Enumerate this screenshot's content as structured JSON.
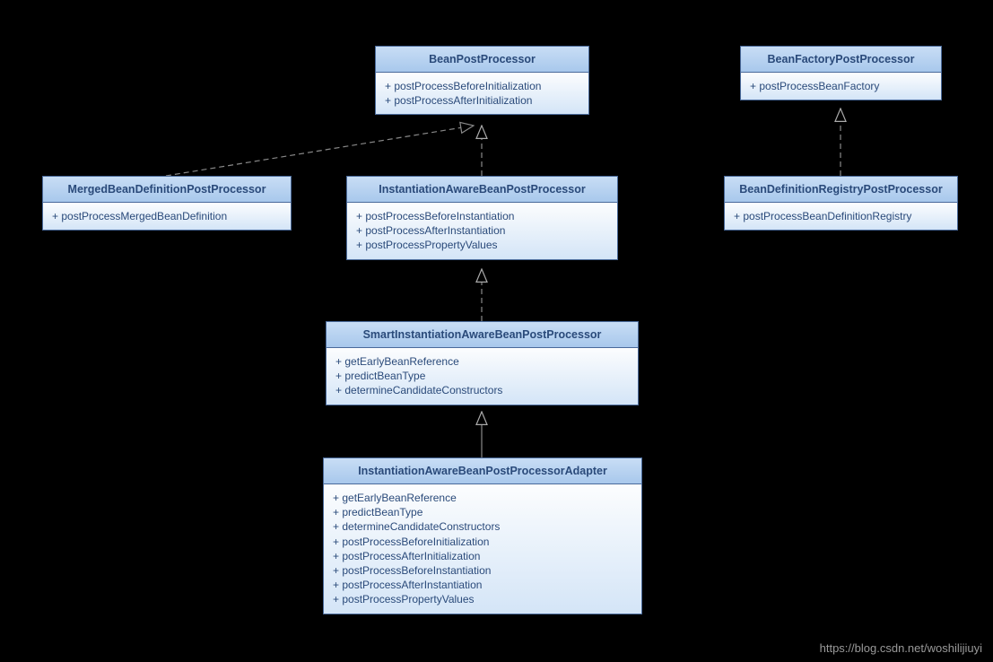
{
  "boxes": {
    "bpp": {
      "title": "BeanPostProcessor",
      "methods": [
        "+ postProcessBeforeInitialization",
        "+ postProcessAfterInitialization"
      ]
    },
    "bfpp": {
      "title": "BeanFactoryPostProcessor",
      "methods": [
        "+ postProcessBeanFactory"
      ]
    },
    "mbdpp": {
      "title": "MergedBeanDefinitionPostProcessor",
      "methods": [
        "+ postProcessMergedBeanDefinition"
      ]
    },
    "iabpp": {
      "title": "InstantiationAwareBeanPostProcessor",
      "methods": [
        "+ postProcessBeforeInstantiation",
        "+ postProcessAfterInstantiation",
        "+ postProcessPropertyValues"
      ]
    },
    "bdrpp": {
      "title": "BeanDefinitionRegistryPostProcessor",
      "methods": [
        "+ postProcessBeanDefinitionRegistry"
      ]
    },
    "siabpp": {
      "title": "SmartInstantiationAwareBeanPostProcessor",
      "methods": [
        "+ getEarlyBeanReference",
        "+ predictBeanType",
        "+ determineCandidateConstructors"
      ]
    },
    "iabppa": {
      "title": "InstantiationAwareBeanPostProcessorAdapter",
      "methods": [
        "+ getEarlyBeanReference",
        "+ predictBeanType",
        "+ determineCandidateConstructors",
        "+ postProcessBeforeInitialization",
        "+ postProcessAfterInitialization",
        "+ postProcessBeforeInstantiation",
        "+ postProcessAfterInstantiation",
        "+ postProcessPropertyValues"
      ]
    }
  },
  "watermark": "https://blog.csdn.net/woshilijiuyi"
}
